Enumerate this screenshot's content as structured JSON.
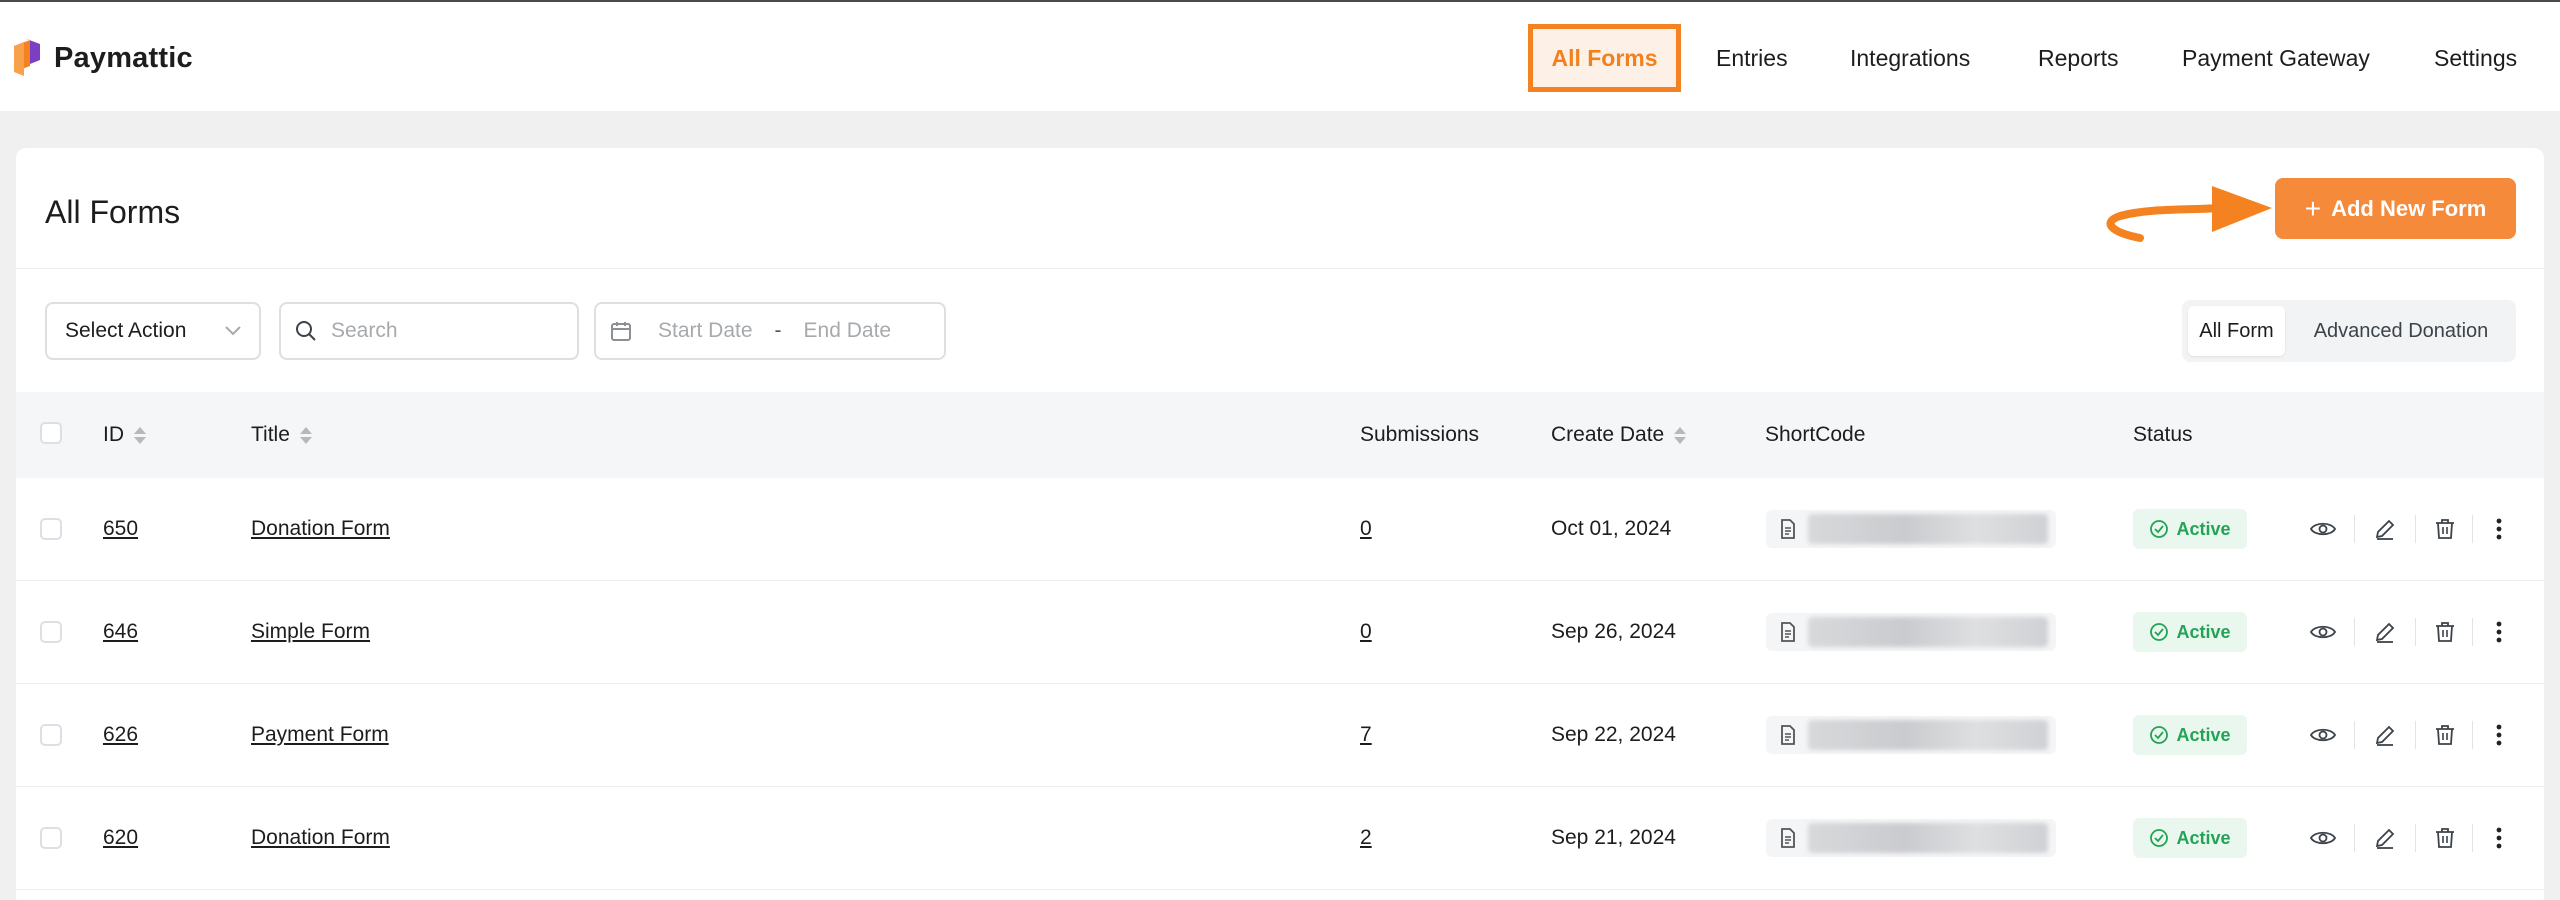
{
  "app": {
    "name": "Paymattic",
    "brand_color": "#f58220",
    "logo_icon": "paymattic-logo"
  },
  "nav": {
    "items": [
      {
        "label": "All Forms",
        "active": true
      },
      {
        "label": "Entries"
      },
      {
        "label": "Integrations"
      },
      {
        "label": "Reports"
      },
      {
        "label": "Payment Gateway"
      },
      {
        "label": "Settings"
      }
    ]
  },
  "page": {
    "title": "All Forms",
    "add_button_label": "Add New Form",
    "add_button_icon": "plus-icon"
  },
  "filters": {
    "select_action": "Select Action",
    "search_placeholder": "Search",
    "start_date_placeholder": "Start Date",
    "date_separator": "-",
    "end_date_placeholder": "End Date",
    "view_toggle": [
      "All Form",
      "Advanced Donation"
    ],
    "view_selected": "All Form"
  },
  "table": {
    "columns": {
      "id": "ID",
      "title": "Title",
      "submissions": "Submissions",
      "create_date": "Create Date",
      "shortcode": "ShortCode",
      "status": "Status"
    },
    "rows": [
      {
        "id": "650",
        "title": "Donation Form",
        "submissions": "0",
        "date": "Oct 01, 2024",
        "status": "Active"
      },
      {
        "id": "646",
        "title": "Simple Form",
        "submissions": "0",
        "date": "Sep 26, 2024",
        "status": "Active"
      },
      {
        "id": "626",
        "title": "Payment Form",
        "submissions": "7",
        "date": "Sep 22, 2024",
        "status": "Active"
      },
      {
        "id": "620",
        "title": "Donation Form",
        "submissions": "2",
        "date": "Sep 21, 2024",
        "status": "Active"
      }
    ],
    "row_action_icons": [
      "eye-icon",
      "edit-icon",
      "trash-icon",
      "more-vertical-icon"
    ],
    "status_color": "#23a454"
  }
}
